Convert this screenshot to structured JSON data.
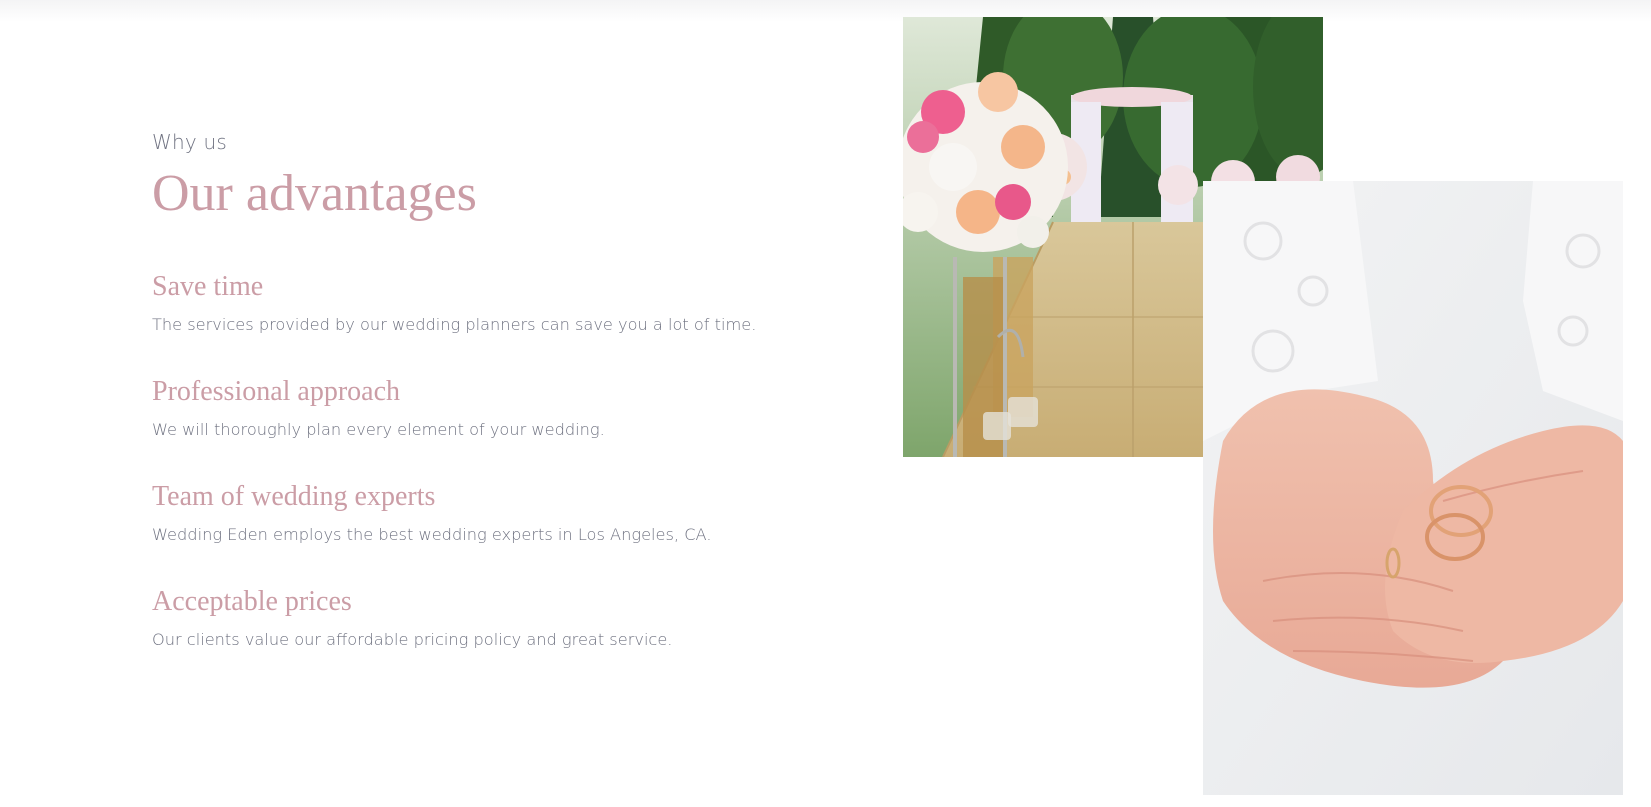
{
  "section": {
    "eyebrow": "Why us",
    "title": "Our advantages"
  },
  "advantages": [
    {
      "title": "Save time",
      "text": "The services provided by our wedding planners can save you a lot of time."
    },
    {
      "title": "Professional approach",
      "text": "We will thoroughly plan every element of your wedding."
    },
    {
      "title": "Team of wedding experts",
      "text": "Wedding Eden employs the best wedding experts in Los Angeles, CA."
    },
    {
      "title": "Acceptable prices",
      "text": "Our clients value our affordable pricing policy and great service."
    }
  ],
  "images": {
    "aisle": "wedding-aisle-photo",
    "rings": "hands-with-rings-photo"
  },
  "colors": {
    "accent": "#cb9da6",
    "body_text": "#6f7281",
    "background": "#ffffff"
  }
}
